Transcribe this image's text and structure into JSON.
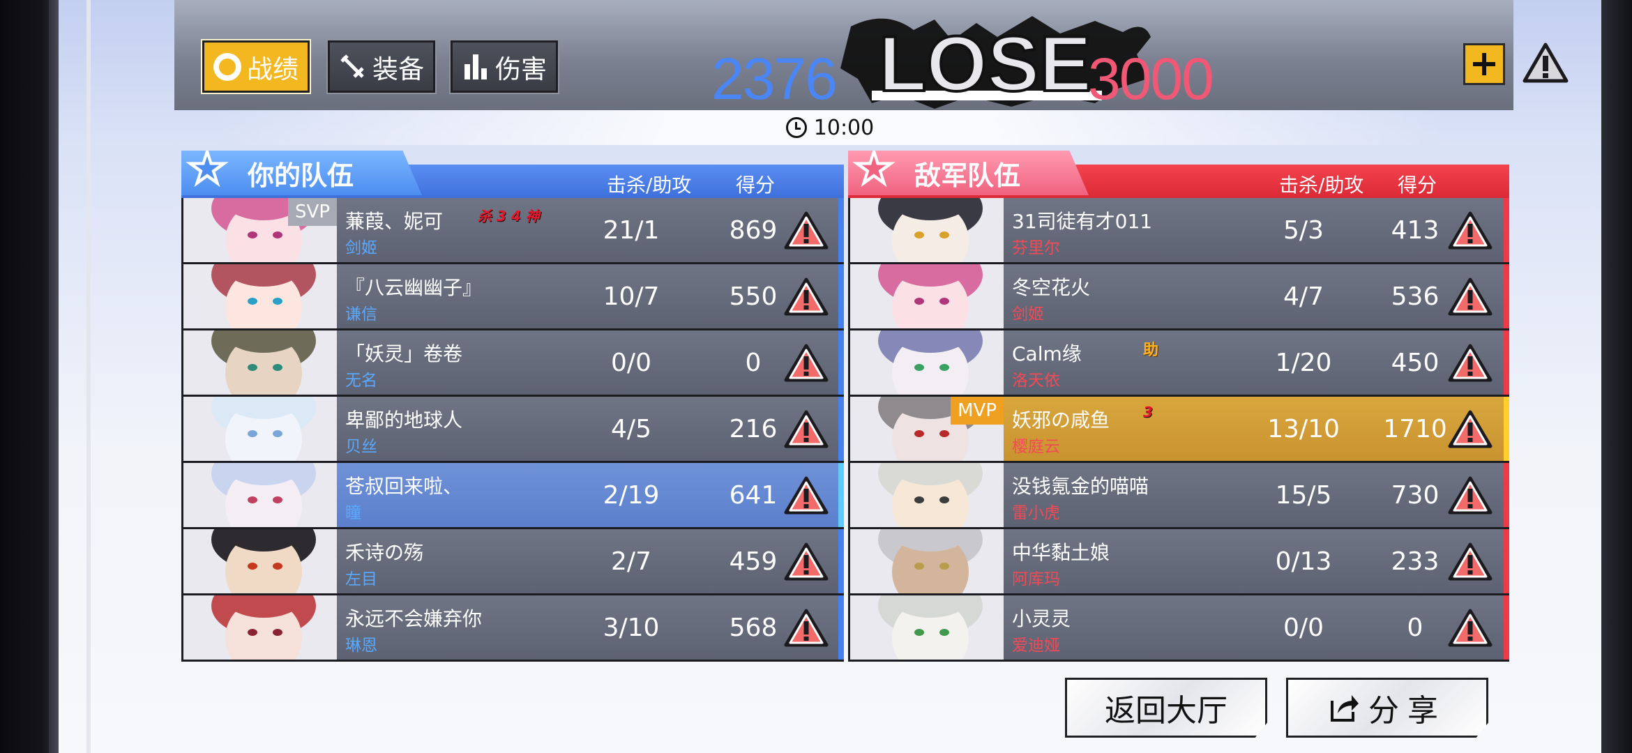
{
  "tabs": [
    {
      "label": "战绩",
      "icon": "target-icon",
      "active": true
    },
    {
      "label": "装备",
      "icon": "tools-icon",
      "active": false
    },
    {
      "label": "伤害",
      "icon": "bar-chart-icon",
      "active": false
    }
  ],
  "result": {
    "text": "LOSE",
    "score_left": "2376",
    "score_right": "3000"
  },
  "timer": {
    "value": "10:00"
  },
  "left_team": {
    "title": "你的队伍",
    "col_ka": "击杀/助攻",
    "col_score": "得分",
    "players": [
      {
        "name": "蒹葭、妮可",
        "hero": "剑姬",
        "kda": "21/1",
        "score": "869",
        "tag": "SVP",
        "badge": "杀 3 4 神",
        "avatar": {
          "hair": "#d86b9f",
          "skin": "#fbe1e6",
          "eye": "#b0367a"
        }
      },
      {
        "name": "『八云幽幽子』",
        "hero": "谦信",
        "kda": "10/7",
        "score": "550",
        "tag": "",
        "badge": "",
        "avatar": {
          "hair": "#b25560",
          "skin": "#fde6df",
          "eye": "#2aa0c6"
        }
      },
      {
        "name": "「妖灵」卷卷",
        "hero": "无名",
        "kda": "0/0",
        "score": "0",
        "tag": "",
        "badge": "",
        "avatar": {
          "hair": "#6e6c58",
          "skin": "#e7d4c2",
          "eye": "#2e8a79"
        }
      },
      {
        "name": "卑鄙的地球人",
        "hero": "贝丝",
        "kda": "4/5",
        "score": "216",
        "tag": "",
        "badge": "",
        "avatar": {
          "hair": "#dbe9f6",
          "skin": "#f1f5fb",
          "eye": "#7aa5d8"
        }
      },
      {
        "name": "苍叔回来啦、",
        "hero": "瞳",
        "kda": "2/19",
        "score": "641",
        "tag": "",
        "badge": "",
        "avatar": {
          "hair": "#c9d5ee",
          "skin": "#f4eef4",
          "eye": "#c0405f"
        }
      },
      {
        "name": "禾诗の殇",
        "hero": "左目",
        "kda": "2/7",
        "score": "459",
        "tag": "",
        "badge": "",
        "avatar": {
          "hair": "#2d2b30",
          "skin": "#f0d9c5",
          "eye": "#c4381e"
        }
      },
      {
        "name": "永远不会嫌弃你",
        "hero": "琳恩",
        "kda": "3/10",
        "score": "568",
        "tag": "",
        "badge": "",
        "avatar": {
          "hair": "#c04a4e",
          "skin": "#f6e0da",
          "eye": "#8a2434"
        }
      }
    ]
  },
  "right_team": {
    "title": "敌军队伍",
    "col_ka": "击杀/助攻",
    "col_score": "得分",
    "players": [
      {
        "name": "31司徒有才011",
        "hero": "芬里尔",
        "kda": "5/3",
        "score": "413",
        "tag": "",
        "badge": "",
        "avatar": {
          "hair": "#3a3a44",
          "skin": "#f6ece6",
          "eye": "#d9a02b"
        }
      },
      {
        "name": "冬空花火",
        "hero": "剑姬",
        "kda": "4/7",
        "score": "536",
        "tag": "",
        "badge": "",
        "avatar": {
          "hair": "#d86b9f",
          "skin": "#fbe1e6",
          "eye": "#b0367a"
        }
      },
      {
        "name": "Calm缘",
        "hero": "洛天依",
        "kda": "1/20",
        "score": "450",
        "tag": "",
        "badge": "助",
        "avatar": {
          "hair": "#8688b8",
          "skin": "#f3eef4",
          "eye": "#3aa064"
        }
      },
      {
        "name": "妖邪の咸鱼",
        "hero": "樱庭云",
        "kda": "13/10",
        "score": "1710",
        "tag": "MVP",
        "badge": "3",
        "avatar": {
          "hair": "#8e8a8e",
          "skin": "#eee3e2",
          "eye": "#b82a2a"
        }
      },
      {
        "name": "没钱氪金的喵喵",
        "hero": "雷小虎",
        "kda": "15/5",
        "score": "730",
        "tag": "",
        "badge": "",
        "avatar": {
          "hair": "#d9dad6",
          "skin": "#f7e7d6",
          "eye": "#3c3c3c"
        }
      },
      {
        "name": "中华黏土娘",
        "hero": "阿库玛",
        "kda": "0/13",
        "score": "233",
        "tag": "",
        "badge": "",
        "avatar": {
          "hair": "#c8c8ce",
          "skin": "#d3b59c",
          "eye": "#b89d4a"
        }
      },
      {
        "name": "小灵灵",
        "hero": "爱迪娅",
        "kda": "0/0",
        "score": "0",
        "tag": "",
        "badge": "",
        "avatar": {
          "hair": "#d5d8d4",
          "skin": "#f3f2ee",
          "eye": "#3f9a4c"
        }
      }
    ]
  },
  "buttons": {
    "lobby": "返回大厅",
    "share": "分享"
  },
  "colors": {
    "accent_yellow": "#f3b81f",
    "ally_blue": "#4681ee",
    "enemy_red": "#f03a48",
    "mvp_gold": "#d9a63d"
  }
}
